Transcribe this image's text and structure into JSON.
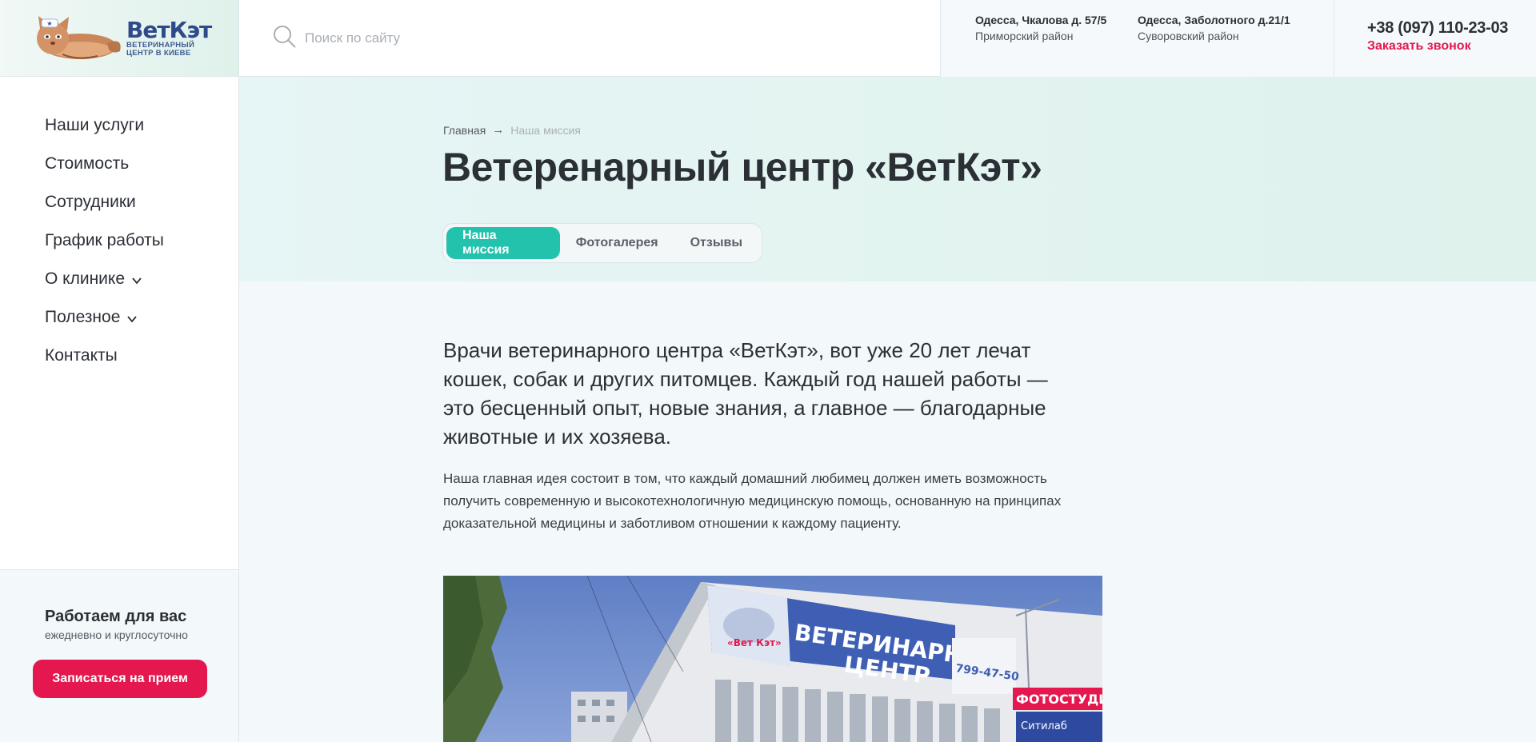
{
  "brand": {
    "name": "ВетКэт",
    "tagline_line1": "ВЕТЕРИНАРНЫЙ",
    "tagline_line2": "ЦЕНТР В КИЕВЕ"
  },
  "search": {
    "placeholder": "Поиск по сайту"
  },
  "addresses": [
    {
      "title": "Одесса, Чкалова д. 57/5",
      "district": "Приморский район"
    },
    {
      "title": "Одесса, Заболотного д.21/1",
      "district": "Суворовский район"
    }
  ],
  "contact": {
    "phone": "+38 (097) 110-23-03",
    "callback_label": "Заказать звонок"
  },
  "sidebar": {
    "items": [
      {
        "label": "Наши услуги",
        "has_dropdown": false
      },
      {
        "label": "Стоимость",
        "has_dropdown": false
      },
      {
        "label": "Сотрудники",
        "has_dropdown": false
      },
      {
        "label": "График работы",
        "has_dropdown": false
      },
      {
        "label": "О клинике",
        "has_dropdown": true
      },
      {
        "label": "Полезное",
        "has_dropdown": true
      },
      {
        "label": "Контакты",
        "has_dropdown": false
      }
    ],
    "work_title": "Работаем для вас",
    "work_subtitle": "ежедневно и круглосуточно",
    "book_button": "Записаться на прием"
  },
  "breadcrumb": {
    "home": "Главная",
    "separator": "→",
    "current": "Наша миссия"
  },
  "page_title": "Ветеренарный центр «ВетКэт»",
  "tabs": [
    {
      "label": "Наша миссия",
      "active": true
    },
    {
      "label": "Фотогалерея",
      "active": false
    },
    {
      "label": "Отзывы",
      "active": false
    }
  ],
  "content": {
    "lead": "Врачи ветеринарного центра «ВетКэт», вот уже 20 лет лечат кошек, собак и других питомцев. Каждый год нашей работы — это бесценный опыт, новые знания, а главное — благодарные животные и их хозяева.",
    "paragraph": "Наша главная идея состоит в том, что каждый домашний любимец должен иметь возможность получить современную и высокотехнологичную медицинскую помощь, основанную на принципах доказательной медицины и заботливом отношении к каждому пациенту."
  },
  "photo_sign": {
    "sign_line1": "ВЕТЕРИНАРНЫЙ",
    "sign_line2": "ЦЕНТР",
    "sign_logo": "«Вет Кэт»",
    "sign_phone": "799-47-50",
    "photo_studio": "ФОТОСТУДИЯ",
    "citilab": "Ситилаб"
  },
  "colors": {
    "accent_teal": "#22c2ad",
    "accent_red": "#e4174f",
    "brand_blue": "#2f4a8a"
  }
}
